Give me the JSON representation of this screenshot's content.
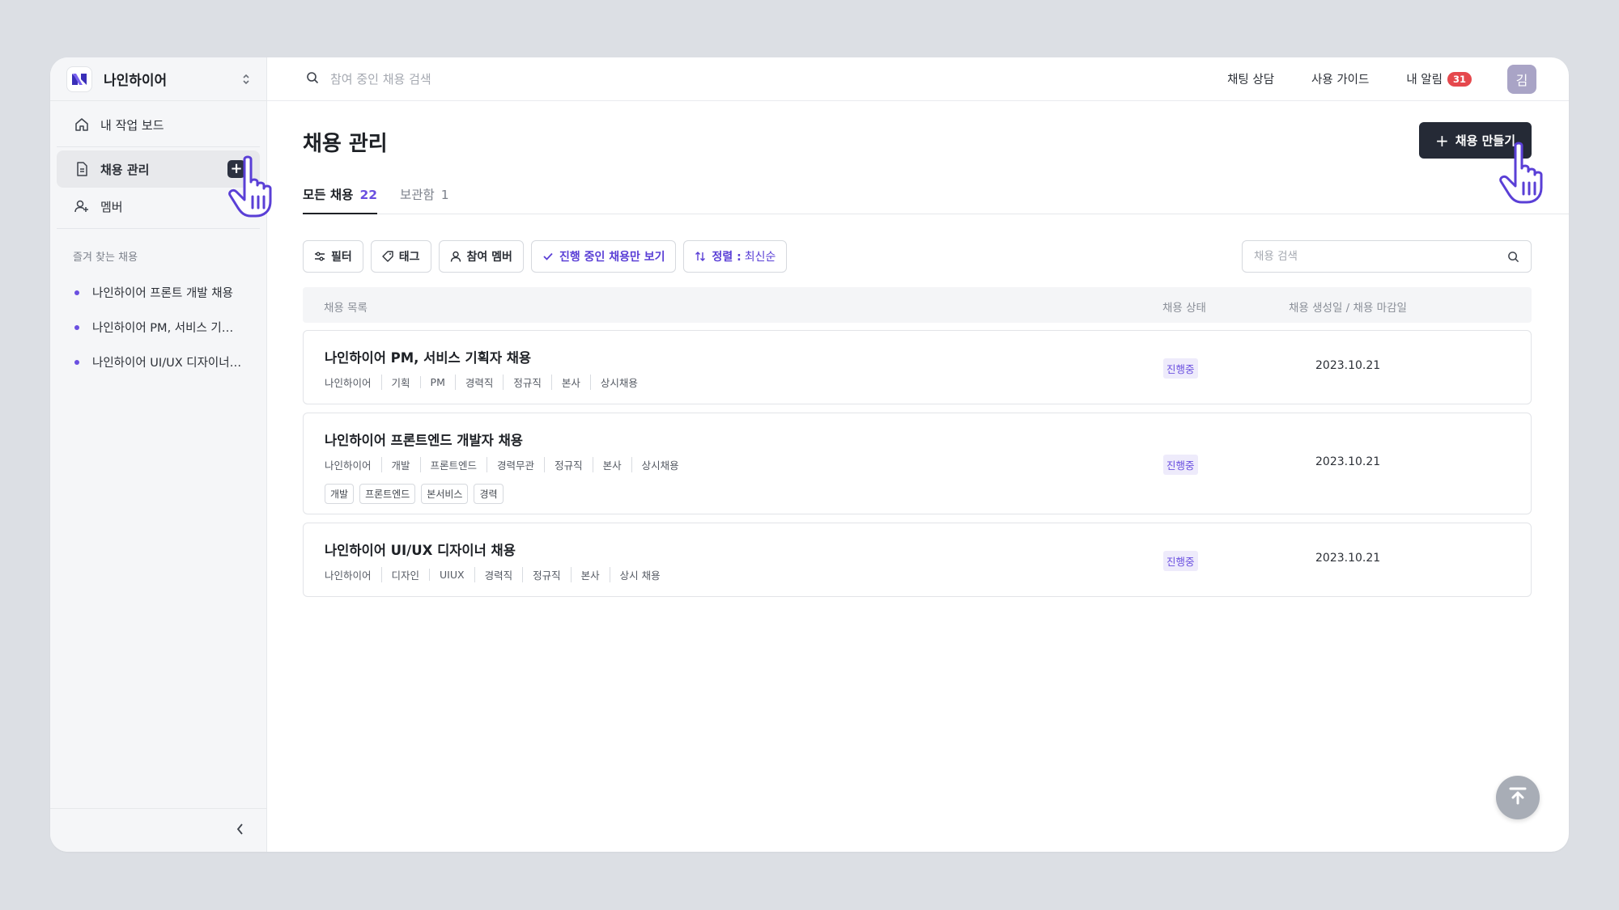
{
  "workspace": {
    "name": "나인하이어"
  },
  "sidebar": {
    "nav": [
      {
        "label": "내 작업 보드",
        "icon": "home-icon"
      },
      {
        "label": "채용 관리",
        "icon": "document-icon",
        "active": true
      },
      {
        "label": "멤버",
        "icon": "add-user-icon"
      }
    ],
    "favorites_title": "즐겨 찾는 채용",
    "favorites": [
      "나인하이어 프론트 개발 채용",
      "나인하이어 PM, 서비스 기획자 채용",
      "나인하이어 UI/UX 디자이너 채용"
    ]
  },
  "topbar": {
    "search_placeholder": "참여 중인 채용 검색",
    "links": [
      "채팅 상담",
      "사용 가이드",
      "내 알림"
    ],
    "notification_count": "31",
    "avatar": "김"
  },
  "page": {
    "title": "채용 관리",
    "create_button": "채용 만들기",
    "tabs": [
      {
        "label": "모든 채용",
        "count": "22",
        "active": true
      },
      {
        "label": "보관함",
        "count": "1",
        "active": false
      }
    ],
    "filters": {
      "filter": "필터",
      "tag": "태그",
      "members": "참여 멤버",
      "active_only": "진행 중인 채용만 보기",
      "sort_label": "정렬 :",
      "sort_value": "최신순"
    },
    "list_search_placeholder": "채용 검색",
    "columns": {
      "list": "채용 목록",
      "status": "채용 상태",
      "dates": "채용 생성일 / 채용 마감일"
    },
    "rows": [
      {
        "title": "나인하이어 PM, 서비스 기획자 채용",
        "meta": [
          "나인하이어",
          "기획",
          "PM",
          "경력직",
          "정규직",
          "본사",
          "상시채용"
        ],
        "tags": [],
        "status": "진행중",
        "date": "2023.10.21"
      },
      {
        "title": "나인하이어 프론트엔드 개발자 채용",
        "meta": [
          "나인하이어",
          "개발",
          "프론트엔드",
          "경력무관",
          "정규직",
          "본사",
          "상시채용"
        ],
        "tags": [
          "개발",
          "프론트엔드",
          "본서비스",
          "경력"
        ],
        "status": "진행중",
        "date": "2023.10.21"
      },
      {
        "title": "나인하이어 UI/UX 디자이너 채용",
        "meta": [
          "나인하이어",
          "디자인",
          "UIUX",
          "경력직",
          "정규직",
          "본사",
          "상시 채용"
        ],
        "tags": [],
        "status": "진행중",
        "date": "2023.10.21"
      }
    ]
  },
  "colors": {
    "accent": "#6a4fe0",
    "dark_button": "#252a36",
    "badge": "#e5484d"
  }
}
